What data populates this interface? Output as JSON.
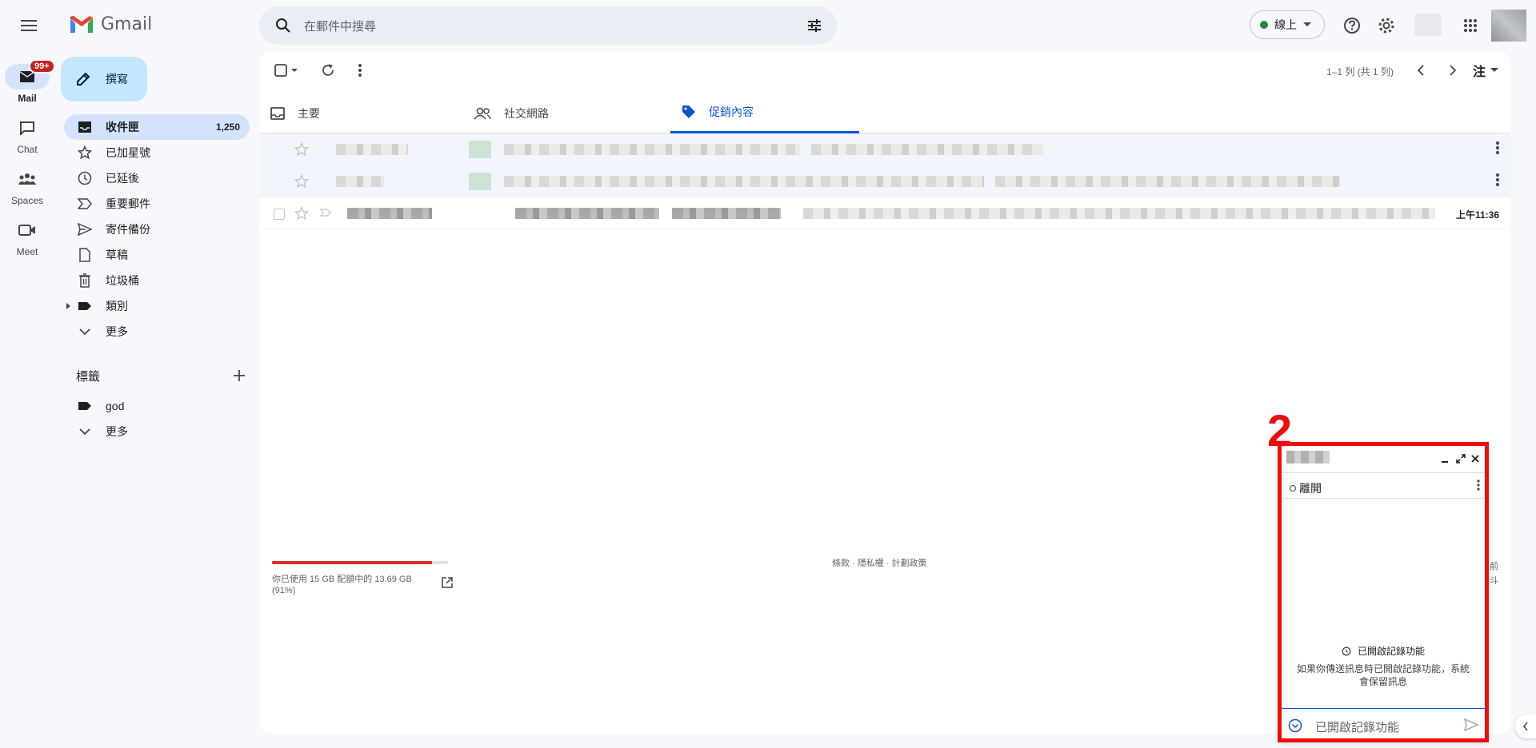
{
  "app": {
    "name": "Gmail"
  },
  "search": {
    "placeholder": "在郵件中搜尋"
  },
  "status": {
    "label": "線上",
    "color": "#1e8e3e"
  },
  "rail": [
    {
      "label": "Mail",
      "badge": "99+",
      "icon": "mail-icon"
    },
    {
      "label": "Chat",
      "icon": "chat-icon"
    },
    {
      "label": "Spaces",
      "icon": "spaces-icon"
    },
    {
      "label": "Meet",
      "icon": "meet-icon"
    }
  ],
  "compose": {
    "label": "撰寫"
  },
  "nav": [
    {
      "label": "收件匣",
      "count": "1,250",
      "icon": "inbox-icon",
      "active": true
    },
    {
      "label": "已加星號",
      "icon": "star-icon"
    },
    {
      "label": "已延後",
      "icon": "clock-icon"
    },
    {
      "label": "重要郵件",
      "icon": "important-icon"
    },
    {
      "label": "寄件備份",
      "icon": "send-icon"
    },
    {
      "label": "草稿",
      "icon": "draft-icon"
    },
    {
      "label": "垃圾桶",
      "icon": "trash-icon"
    },
    {
      "label": "類別",
      "icon": "label-icon"
    },
    {
      "label": "更多",
      "icon": "chevron-down-icon"
    }
  ],
  "labels": {
    "title": "標籤",
    "items": [
      {
        "label": "god",
        "icon": "label-icon"
      },
      {
        "label": "更多",
        "icon": "chevron-down-icon"
      }
    ]
  },
  "toolbar": {
    "pagination": "1–1 列 (共 1 列)",
    "input_tool": "注"
  },
  "tabs": [
    {
      "label": "主要",
      "icon": "inbox-icon"
    },
    {
      "label": "社交網路",
      "icon": "people-icon"
    },
    {
      "label": "促銷內容",
      "icon": "tag-icon",
      "active": true
    }
  ],
  "emails": [
    {
      "time": ""
    },
    {
      "time": ""
    },
    {
      "time": "上午11:36"
    }
  ],
  "storage": {
    "used_fraction": 0.91,
    "text": "你已使用 15 GB 配額中的 13.69 GB (91%)"
  },
  "footer": {
    "text": "條款 · 隱私權 · 計劃政策"
  },
  "chat": {
    "annotation": "2",
    "presence": "離開",
    "history_title": "已開啟記錄功能",
    "history_desc": "如果你傳送訊息時已開啟記錄功能，系統會保留訊息",
    "input_placeholder": "已開啟記錄功能",
    "outline_color": "#ee0d0d"
  },
  "peek": {
    "line1": "前",
    "line2": "斗"
  }
}
